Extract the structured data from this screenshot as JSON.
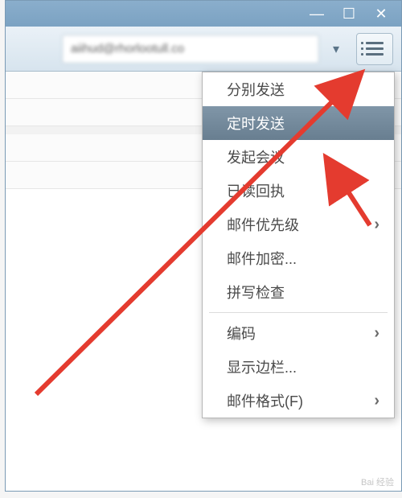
{
  "window_controls": {
    "minimize": "—",
    "maximize": "☐",
    "close": "✕"
  },
  "toolbar": {
    "email_display": "aiihud@rhorlootull.co",
    "caret": "▾"
  },
  "menu": {
    "items": [
      {
        "label": "分别发送",
        "has_submenu": false
      },
      {
        "label": "定时发送",
        "has_submenu": false,
        "selected": true
      },
      {
        "label": "发起会议",
        "has_submenu": false
      },
      {
        "label": "已读回执",
        "has_submenu": false
      },
      {
        "label": "邮件优先级",
        "has_submenu": true
      },
      {
        "label": "邮件加密...",
        "has_submenu": false
      },
      {
        "label": "拼写检查",
        "has_submenu": false
      },
      {
        "label": "编码",
        "has_submenu": true
      },
      {
        "label": "显示边栏...",
        "has_submenu": false
      },
      {
        "label": "邮件格式(F)",
        "has_submenu": true
      }
    ],
    "chevron_glyph": "›"
  },
  "watermark": "Bai 经验"
}
